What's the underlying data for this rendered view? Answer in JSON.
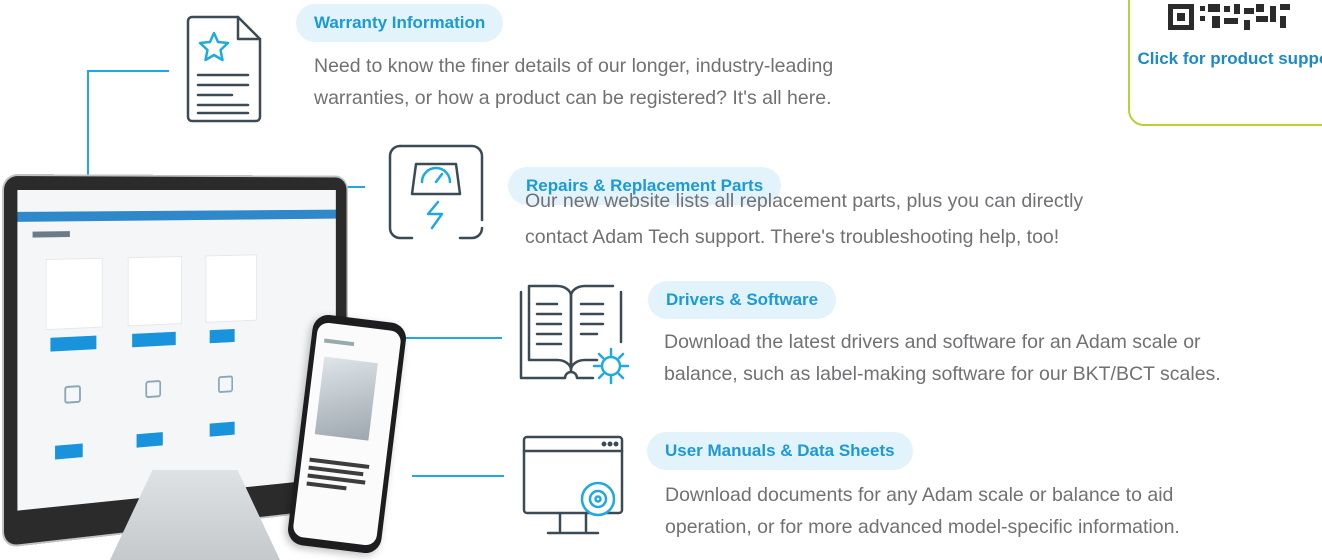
{
  "qr": {
    "label": "Click for product support"
  },
  "sections": [
    {
      "id": "warranty",
      "title": "Warranty Information",
      "line1": "Need to know the finer details of our longer, industry-leading",
      "line2": "warranties, or how a product can be registered? It's all here.",
      "icon": "document-star-icon"
    },
    {
      "id": "repairs",
      "title": "Repairs & Replacement Parts",
      "line1": "Our new website lists all replacement parts, plus you can directly",
      "line2": "contact Adam Tech support. There's troubleshooting help, too!",
      "icon": "broken-scale-icon"
    },
    {
      "id": "drivers",
      "title": "Drivers & Software",
      "line1": "Download the latest drivers and software for an Adam scale or",
      "line2": "balance, such as label-making software for our BKT/BCT scales.",
      "icon": "book-gear-icon"
    },
    {
      "id": "manuals",
      "title": "User Manuals & Data Sheets",
      "line1": "Download documents for any Adam scale or balance to aid",
      "line2": "operation, or for more advanced model-specific information.",
      "icon": "monitor-disc-icon"
    }
  ],
  "colors": {
    "accent_blue": "#1b9ad6",
    "pill_bg": "#e3f3fb",
    "body_text": "#707173",
    "connector_line": "#1fa9e1",
    "qr_border": "#b5d334",
    "icon_stroke": "#3b4a55"
  }
}
